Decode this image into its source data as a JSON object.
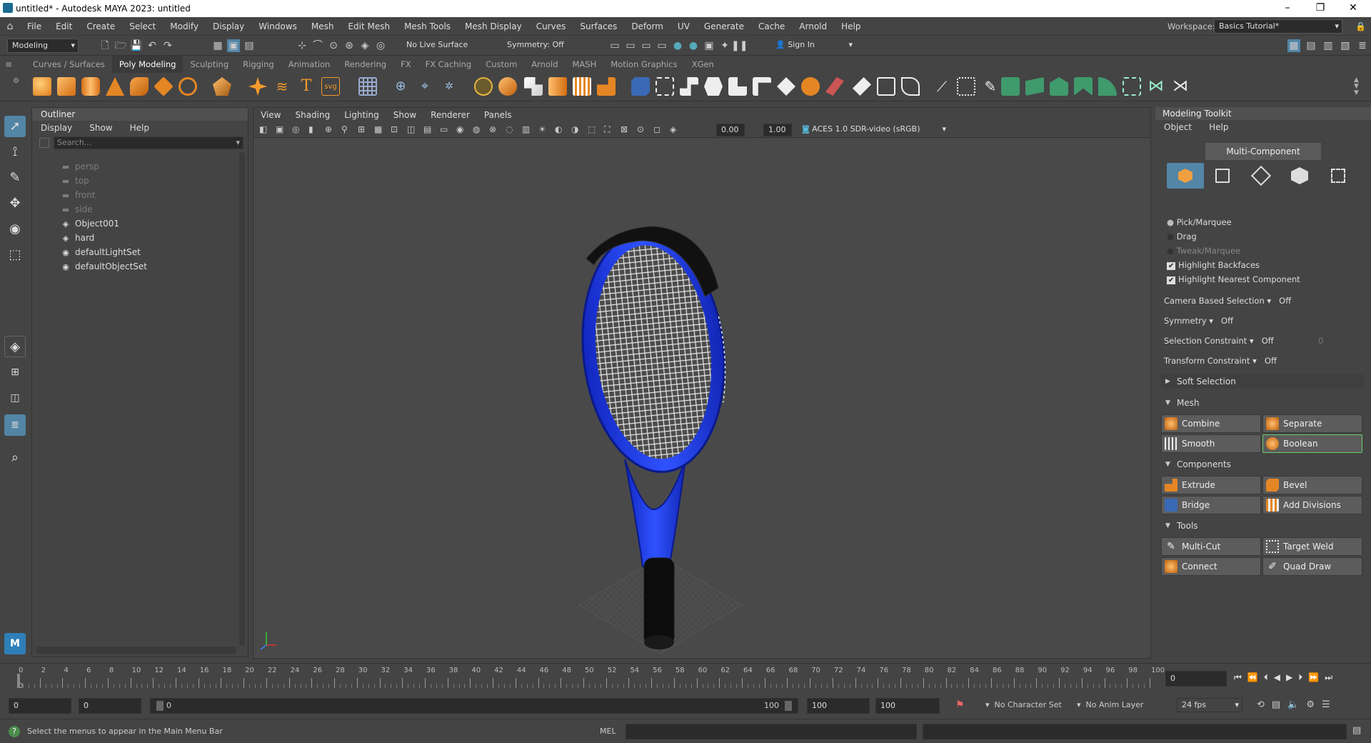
{
  "window": {
    "title": "untitled* - Autodesk MAYA 2023: untitled"
  },
  "menubar": {
    "items": [
      "File",
      "Edit",
      "Create",
      "Select",
      "Modify",
      "Display",
      "Windows",
      "Mesh",
      "Edit Mesh",
      "Mesh Tools",
      "Mesh Display",
      "Curves",
      "Surfaces",
      "Deform",
      "UV",
      "Generate",
      "Cache",
      "Arnold",
      "Help"
    ],
    "workspace_label": "Workspace:",
    "workspace_value": "Basics Tutorial*"
  },
  "statusline": {
    "mode": "Modeling",
    "live_surface": "No Live Surface",
    "symmetry": "Symmetry: Off",
    "sign_in": "Sign In"
  },
  "shelf_tabs": [
    "Curves / Surfaces",
    "Poly Modeling",
    "Sculpting",
    "Rigging",
    "Animation",
    "Rendering",
    "FX",
    "FX Caching",
    "Custom",
    "Arnold",
    "MASH",
    "Motion Graphics",
    "XGen"
  ],
  "active_shelf": "Poly Modeling",
  "outliner": {
    "title": "Outliner",
    "menu": [
      "Display",
      "Show",
      "Help"
    ],
    "search_placeholder": "Search...",
    "items": [
      {
        "label": "persp",
        "icon": "camera-icon",
        "dim": true
      },
      {
        "label": "top",
        "icon": "camera-icon",
        "dim": true
      },
      {
        "label": "front",
        "icon": "camera-icon",
        "dim": true
      },
      {
        "label": "side",
        "icon": "camera-icon",
        "dim": true
      },
      {
        "label": "Object001",
        "icon": "transform-icon",
        "dim": false
      },
      {
        "label": "hard",
        "icon": "transform-icon",
        "dim": false
      },
      {
        "label": "defaultLightSet",
        "icon": "set-icon",
        "dim": false
      },
      {
        "label": "defaultObjectSet",
        "icon": "set-icon",
        "dim": false
      }
    ]
  },
  "viewport": {
    "menu": [
      "View",
      "Shading",
      "Lighting",
      "Show",
      "Renderer",
      "Panels"
    ],
    "exposure": "0.00",
    "gamma": "1.00",
    "color_space": "ACES 1.0 SDR-video (sRGB)"
  },
  "toolkit": {
    "title": "Modeling Toolkit",
    "menu": [
      "Object",
      "Help"
    ],
    "mode_button": "Multi-Component",
    "selection_modes": [
      "Pick/Marquee",
      "Drag",
      "Tweak/Marquee"
    ],
    "checks": [
      "Highlight Backfaces",
      "Highlight Nearest Component"
    ],
    "settings": [
      {
        "label": "Camera Based Selection",
        "value": "Off"
      },
      {
        "label": "Symmetry",
        "value": "Off"
      },
      {
        "label": "Selection Constraint",
        "value": "Off",
        "extra": "0"
      },
      {
        "label": "Transform Constraint",
        "value": "Off"
      }
    ],
    "soft_selection": "Soft Selection",
    "sections": {
      "mesh": "Mesh",
      "components": "Components",
      "tools": "Tools"
    },
    "mesh_buttons": [
      "Combine",
      "Separate",
      "Smooth",
      "Boolean"
    ],
    "component_buttons": [
      "Extrude",
      "Bevel",
      "Bridge",
      "Add Divisions"
    ],
    "tool_buttons": [
      "Multi-Cut",
      "Target Weld",
      "Connect",
      "Quad Draw"
    ]
  },
  "timeline": {
    "ticks": [
      "0",
      "2",
      "4",
      "6",
      "8",
      "10",
      "12",
      "14",
      "16",
      "18",
      "20",
      "22",
      "24",
      "26",
      "28",
      "30",
      "32",
      "34",
      "36",
      "38",
      "40",
      "42",
      "44",
      "46",
      "48",
      "50",
      "52",
      "54",
      "56",
      "58",
      "60",
      "62",
      "64",
      "66",
      "68",
      "70",
      "72",
      "74",
      "76",
      "78",
      "80",
      "82",
      "84",
      "86",
      "88",
      "90",
      "92",
      "94",
      "96",
      "98",
      "100"
    ],
    "current_frame": "0",
    "frame_field": "0"
  },
  "range": {
    "start": "0",
    "anim_start": "0",
    "slider_start": "0",
    "slider_end": "100",
    "anim_end": "100",
    "end": "100",
    "character_set": "No Character Set",
    "anim_layer": "No Anim Layer",
    "fps": "24 fps"
  },
  "command": {
    "help_text": "Select the menus to appear in the Main Menu Bar",
    "mel_label": "MEL"
  },
  "colors": {
    "racket_frame": "#1f3fe6",
    "grip": "#0a0a0a",
    "strings": "#e8e8e8",
    "accent": "#5285a6"
  }
}
